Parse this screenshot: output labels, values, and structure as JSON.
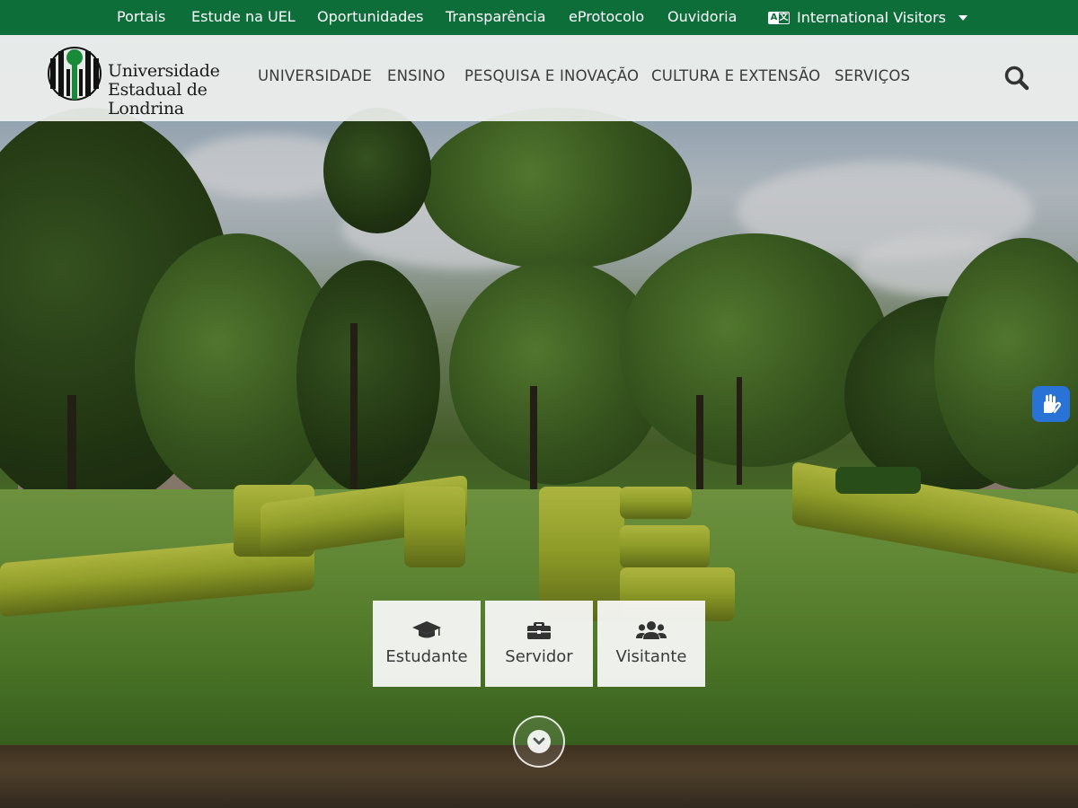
{
  "topbar": {
    "links": [
      "Portais",
      "Estude na UEL",
      "Oportunidades",
      "Transparência",
      "eProtocolo",
      "Ouvidoria"
    ],
    "international": {
      "label": "International Visitors",
      "icon": "language-icon",
      "caret": "caret-down-icon"
    },
    "background_color": "#0d6e3a"
  },
  "logo": {
    "line1": "Universidade",
    "line2": "Estadual de Londrina",
    "mark_colors": {
      "primary": "#111111",
      "accent": "#1a8a3a"
    }
  },
  "nav": {
    "items": [
      "UNIVERSIDADE",
      "ENSINO",
      "PESQUISA E INOVAÇÃO",
      "CULTURA E EXTENSÃO",
      "SERVIÇOS"
    ],
    "search_icon": "search-icon"
  },
  "quick_access": [
    {
      "label": "Estudante",
      "icon": "graduation-cap-icon"
    },
    {
      "label": "Servidor",
      "icon": "briefcase-icon"
    },
    {
      "label": "Visitante",
      "icon": "users-icon"
    }
  ],
  "scroll_down_icon": "chevron-down-icon",
  "accessibility_widget_icon": "sign-language-hands-icon",
  "colors": {
    "brand_green": "#0d6e3a",
    "widget_blue": "#2a73d6"
  }
}
